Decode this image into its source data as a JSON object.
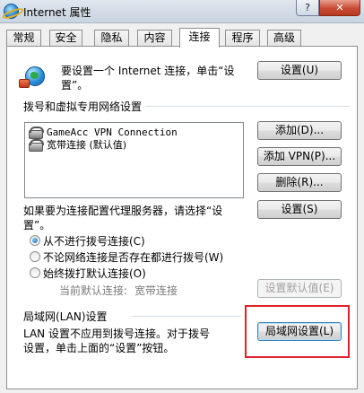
{
  "window": {
    "title": "Internet 属性",
    "help_label": "?",
    "close_label": "✕"
  },
  "tabs": [
    {
      "label": "常规"
    },
    {
      "label": "安全"
    },
    {
      "label": "隐私"
    },
    {
      "label": "内容"
    },
    {
      "label": "连接"
    },
    {
      "label": "程序"
    },
    {
      "label": "高级"
    }
  ],
  "active_tab": "连接",
  "setup": {
    "text_line1": "要设置一个 Internet 连接，单击“设",
    "text_line2": "置”。",
    "button": "设置(U)"
  },
  "dialup": {
    "heading": "拨号和虚拟专用网络设置",
    "list": [
      {
        "label": "GameAcc VPN Connection",
        "icon": "dialup-connection-icon"
      },
      {
        "label": "宽带连接 (默认值)",
        "icon": "dialup-connection-icon"
      }
    ],
    "add_button": "添加(D)...",
    "add_vpn_button": "添加 VPN(P)...",
    "delete_button": "删除(R)..."
  },
  "proxy": {
    "text_line1": "如果要为连接配置代理服务器，请选择“设",
    "text_line2": "置”。",
    "button": "设置(S)"
  },
  "dial_options": {
    "options": [
      {
        "label": "从不进行拨号连接(C)",
        "checked": true
      },
      {
        "label": "不论网络连接是否存在都进行拨号(W)",
        "checked": false
      },
      {
        "label": "始终拨打默认连接(O)",
        "checked": false
      }
    ],
    "current_default_label": "当前默认连接:",
    "current_default_value": "宽带连接",
    "set_default_button": "设置默认值(E)"
  },
  "lan": {
    "heading": "局域网(LAN)设置",
    "text_line1": "LAN 设置不应用到拨号连接。对于拨号",
    "text_line2": "设置，单击上面的“设置”按钮。",
    "button": "局域网设置(L)"
  },
  "colors": {
    "highlight_border": "#e0202a",
    "disabled_text": "#a0a0a0"
  }
}
